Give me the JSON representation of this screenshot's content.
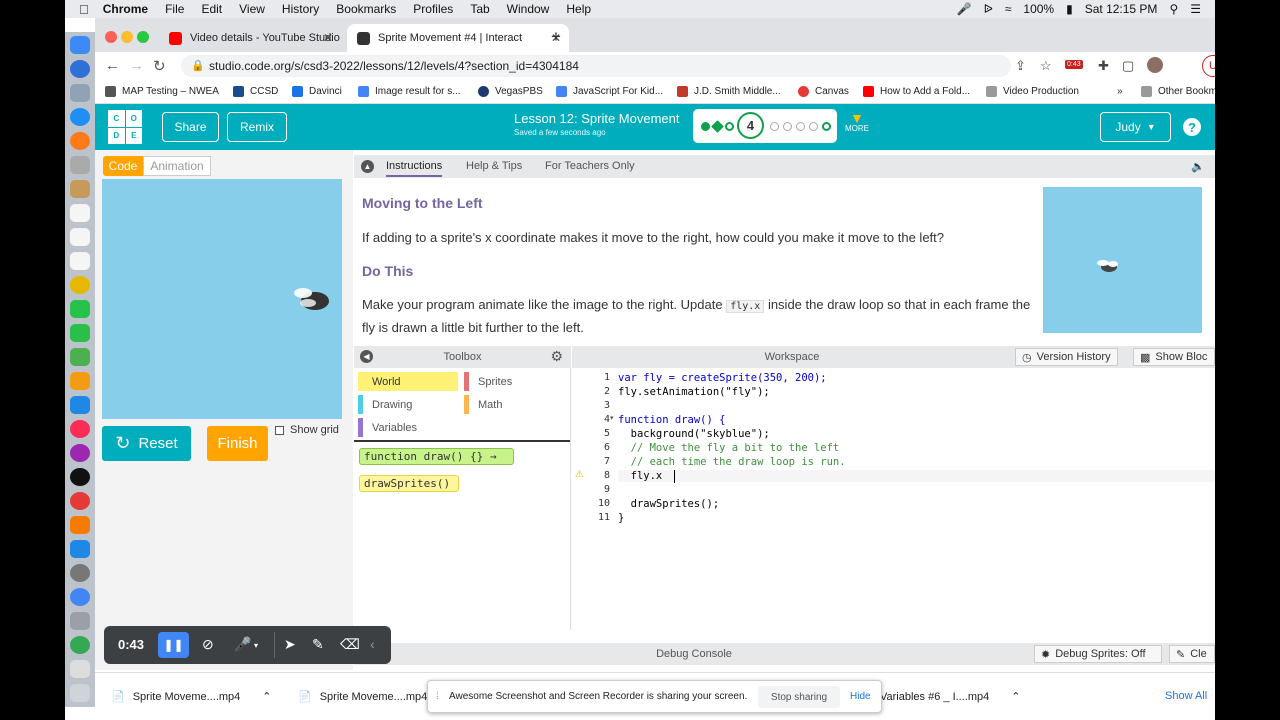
{
  "menubar": {
    "app": "Chrome",
    "items": [
      "File",
      "Edit",
      "View",
      "History",
      "Bookmarks",
      "Profiles",
      "Tab",
      "Window",
      "Help"
    ],
    "battery": "100%",
    "clock": "Sat 12:15 PM"
  },
  "tabs": [
    {
      "title": "Video details - YouTube Studio",
      "active": false
    },
    {
      "title": "Sprite Movement #4 | Interact",
      "active": true
    }
  ],
  "toolbar": {
    "url": "studio.code.org/s/csd3-2022/lessons/12/levels/4?section_id=4304184",
    "update_label": "Update",
    "badge_time": "0:43"
  },
  "bookmarks": [
    "MAP Testing – NWEA",
    "CCSD",
    "Davinci",
    "Image result for s...",
    "VegasPBS",
    "JavaScript For Kid...",
    "J.D. Smith Middle...",
    "Canvas",
    "How to Add a Fold...",
    "Video Production",
    "Other Bookm"
  ],
  "header": {
    "logo_letters": [
      "C",
      "O",
      "D",
      "E"
    ],
    "share_label": "Share",
    "remix_label": "Remix",
    "lesson_title": "Lesson 12: Sprite Movement",
    "saved_text": "Saved a few seconds ago",
    "current_level": "4",
    "more_label": "MORE",
    "user_name": "Judy",
    "help_label": "?"
  },
  "left": {
    "code_toggle": "Code",
    "animation_toggle": "Animation",
    "reset_label": "Reset",
    "finish_label": "Finish",
    "show_grid_label": "Show grid"
  },
  "instructions": {
    "tabs": [
      "Instructions",
      "Help & Tips",
      "For Teachers Only"
    ],
    "heading1": "Moving to the Left",
    "para1": "If adding to a sprite's x coordinate makes it move to the right, how could you make it move to the left?",
    "heading2": "Do This",
    "para2_a": "Make your program animate like the image to the right. Update",
    "para2_code": "fly.x",
    "para2_b": "inside the draw loop so that in each frame the fly is drawn a little bit further to the left."
  },
  "toolbox": {
    "title": "Toolbox",
    "categories": [
      {
        "label": "World",
        "color": "#fff176"
      },
      {
        "label": "Sprites",
        "color": "#e57373"
      },
      {
        "label": "Drawing",
        "color": "#4dd0e1"
      },
      {
        "label": "Math",
        "color": "#ffb74d"
      },
      {
        "label": "Variables",
        "color": "#9575cd"
      }
    ],
    "block1": "function draw() {} →",
    "block2": "drawSprites()"
  },
  "workspace": {
    "title": "Workspace",
    "version_history": "Version History",
    "show_blocks": "Show Bloc",
    "lines": [
      "var fly = createSprite(350, 200);",
      "fly.setAnimation(\"fly\");",
      "",
      "function draw() {",
      "  background(\"skyblue\");",
      "  // Move the fly a bit to the left",
      "  // each time the draw loop is run.",
      "  fly.x ",
      "",
      "  drawSprites();",
      "}"
    ],
    "line_numbers": [
      "1",
      "2",
      "3",
      "4",
      "5",
      "6",
      "7",
      "8",
      "9",
      "10",
      "11"
    ]
  },
  "debug": {
    "title": "Debug Console",
    "sprites_btn": "Debug Sprites: Off",
    "clear_btn": "Cle"
  },
  "downloads": {
    "items": [
      "Sprite Moveme....mp4",
      "Sprite Moveme....mp4",
      "Variables #6 _ I....mp4"
    ],
    "show_all": "Show All"
  },
  "share_notice": {
    "text": "Awesome Screenshot and Screen Recorder is sharing your screen.",
    "stop": "Stop sharing",
    "hide": "Hide"
  },
  "recorder": {
    "time": "0:43"
  }
}
